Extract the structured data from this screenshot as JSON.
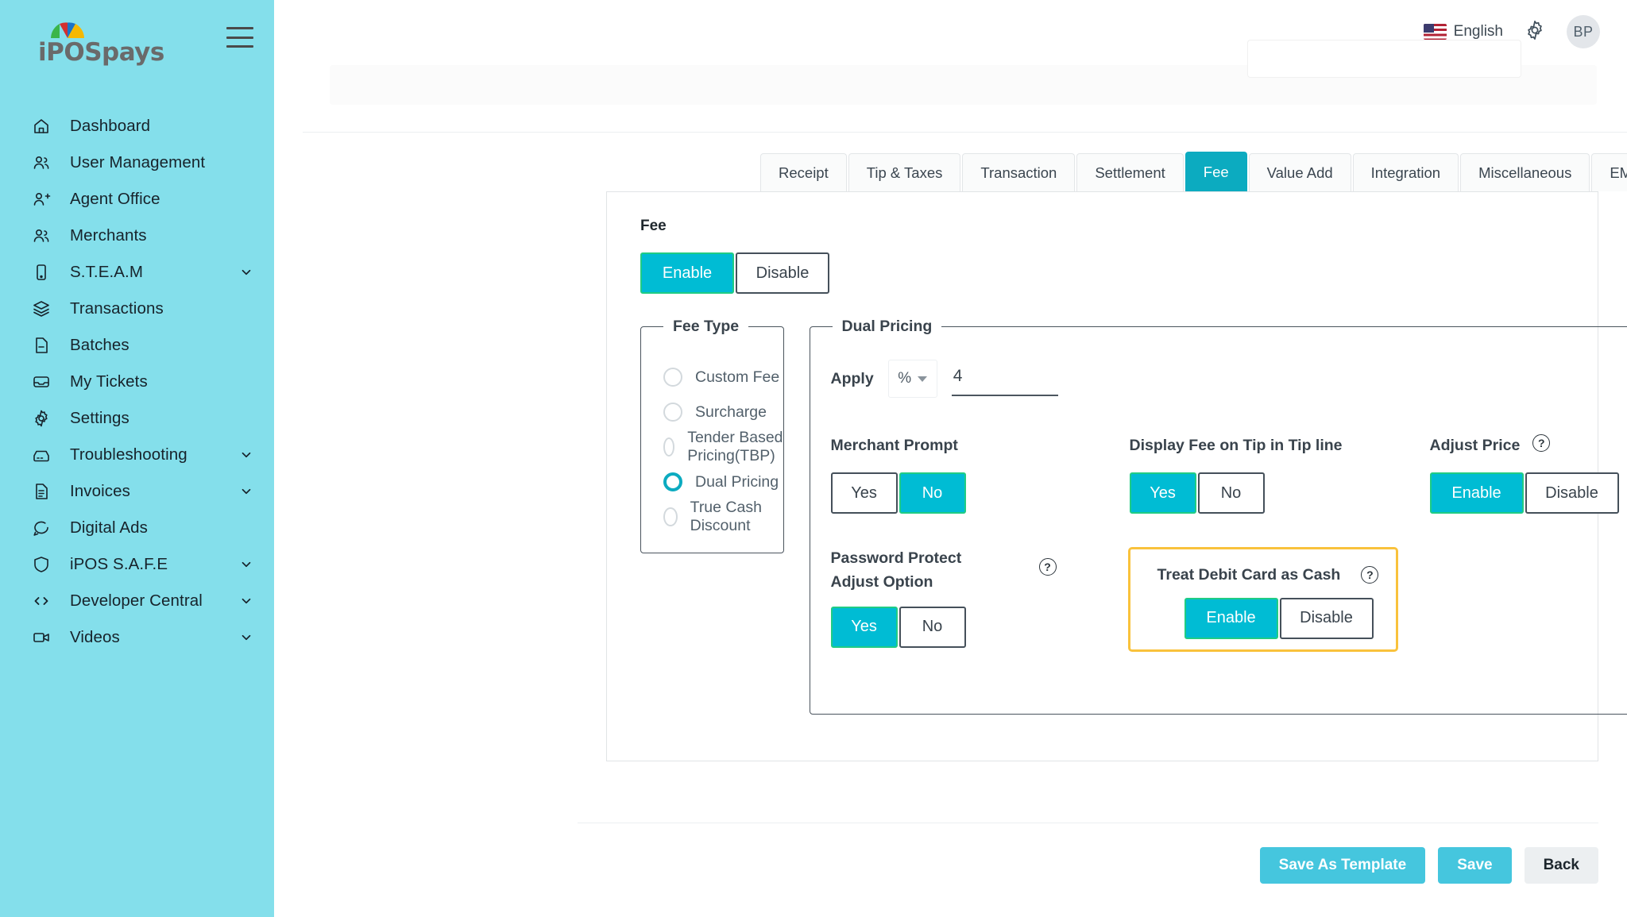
{
  "brand": {
    "logo_text": "iPOSpays",
    "sidebar_color": "#84DFEB"
  },
  "header": {
    "language": "English",
    "flag_icon": "us-flag-icon",
    "gear_icon": "gear-icon",
    "avatar_initials": "BP"
  },
  "sidebar": {
    "menu_icon": "hamburger-icon",
    "items": [
      {
        "label": "Dashboard",
        "icon": "home-icon",
        "expandable": false
      },
      {
        "label": "User Management",
        "icon": "users-icon",
        "expandable": false
      },
      {
        "label": "Agent Office",
        "icon": "user-plus-icon",
        "expandable": false
      },
      {
        "label": "Merchants",
        "icon": "users-icon",
        "expandable": false
      },
      {
        "label": "S.T.E.A.M",
        "icon": "mobile-icon",
        "expandable": true
      },
      {
        "label": "Transactions",
        "icon": "layers-icon",
        "expandable": false
      },
      {
        "label": "Batches",
        "icon": "file-minus-icon",
        "expandable": false
      },
      {
        "label": "My Tickets",
        "icon": "inbox-icon",
        "expandable": false
      },
      {
        "label": "Settings",
        "icon": "gear-icon",
        "expandable": false
      },
      {
        "label": "Troubleshooting",
        "icon": "toolbox-icon",
        "expandable": true
      },
      {
        "label": "Invoices",
        "icon": "document-icon",
        "expandable": true
      },
      {
        "label": "Digital Ads",
        "icon": "chat-bubble-icon",
        "expandable": false
      },
      {
        "label": "iPOS S.A.F.E",
        "icon": "shield-icon",
        "expandable": true
      },
      {
        "label": "Developer Central",
        "icon": "code-icon",
        "expandable": true
      },
      {
        "label": "Videos",
        "icon": "video-camera-icon",
        "expandable": true
      }
    ]
  },
  "tabs": [
    {
      "label": "Receipt",
      "active": false
    },
    {
      "label": "Tip & Taxes",
      "active": false
    },
    {
      "label": "Transaction",
      "active": false
    },
    {
      "label": "Settlement",
      "active": false
    },
    {
      "label": "Fee",
      "active": true
    },
    {
      "label": "Value Add",
      "active": false
    },
    {
      "label": "Integration",
      "active": false
    },
    {
      "label": "Miscellaneous",
      "active": false
    },
    {
      "label": "EMV",
      "active": false
    }
  ],
  "fee": {
    "title": "Fee",
    "enable_label": "Enable",
    "disable_label": "Disable",
    "selected": "Enable"
  },
  "fee_type": {
    "legend": "Fee Type",
    "options": [
      {
        "label": "Custom Fee",
        "selected": false
      },
      {
        "label": "Surcharge",
        "selected": false
      },
      {
        "label": "Tender Based Pricing(TBP)",
        "selected": false
      },
      {
        "label": "Dual Pricing",
        "selected": true
      },
      {
        "label": "True Cash Discount",
        "selected": false
      }
    ]
  },
  "dual_pricing": {
    "legend": "Dual Pricing",
    "apply": {
      "label": "Apply",
      "unit_value": "%",
      "unit_options": [
        "%",
        "$"
      ],
      "amount": "4",
      "amount_placeholder": ""
    },
    "merchant_prompt": {
      "label": "Merchant Prompt",
      "yes_label": "Yes",
      "no_label": "No",
      "selected": "No",
      "has_help": false
    },
    "display_fee_tip": {
      "label": "Display Fee on Tip in Tip line",
      "yes_label": "Yes",
      "no_label": "No",
      "selected": "Yes",
      "has_help": false
    },
    "adjust_price": {
      "label": "Adjust Price",
      "enable_label": "Enable",
      "disable_label": "Disable",
      "selected": "Enable",
      "has_help": true,
      "help_icon": "question-mark-icon"
    },
    "password_protect": {
      "label": "Password Protect Adjust Option",
      "yes_label": "Yes",
      "no_label": "No",
      "selected": "Yes",
      "has_help": true,
      "help_icon": "question-mark-icon"
    },
    "treat_debit_as_cash": {
      "label": "Treat Debit Card as Cash",
      "enable_label": "Enable",
      "disable_label": "Disable",
      "selected": "Enable",
      "has_help": true,
      "help_icon": "question-mark-icon",
      "highlight_color": "#F9C23C"
    }
  },
  "footer": {
    "save_as_template_label": "Save As Template",
    "save_label": "Save",
    "back_label": "Back"
  },
  "colors": {
    "accent_teal": "#00BCD4",
    "accent_green_border": "#20CC84",
    "tab_active": "#0CABC0",
    "button_blue": "#45C6DE",
    "highlight_amber": "#F9C23C"
  }
}
